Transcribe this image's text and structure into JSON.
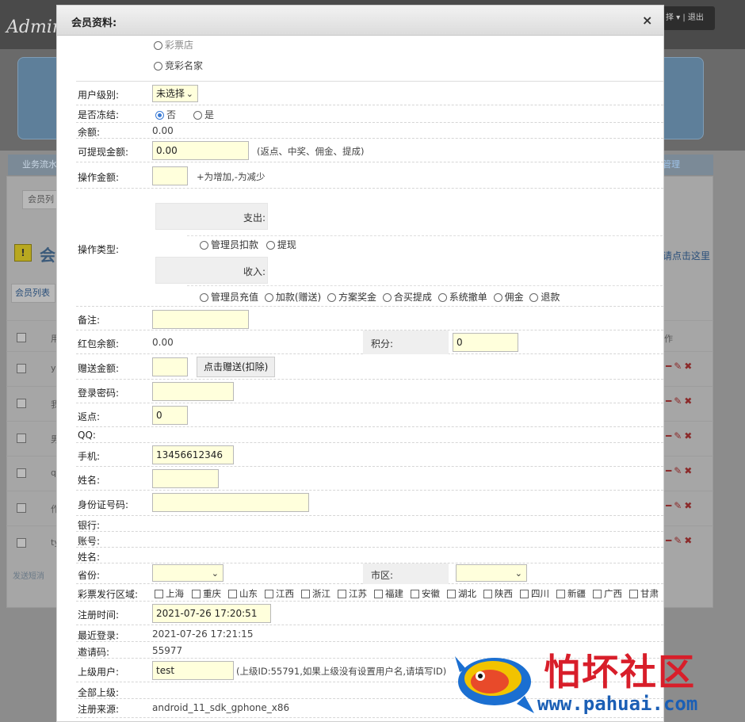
{
  "background": {
    "app_title": "Admin",
    "user_box": "择 ▾ | 退出",
    "nav_left": "业务流水",
    "nav_right": "管理",
    "crumb": "会员列",
    "heading": "会",
    "help_link": "请点击这里",
    "tab": "会员列表",
    "col_head": "用",
    "col_op": "作",
    "rows": [
      "y",
      "我",
      "男",
      "q",
      "作",
      "ty"
    ],
    "footer": "发送短消"
  },
  "modal": {
    "title": "会员资料:",
    "close_symbol": "×",
    "top_partial": "彩票店",
    "top_option": "竞彩名家",
    "level": {
      "label": "用户级别:",
      "value": "未选择"
    },
    "frozen": {
      "label": "是否冻结:",
      "no": "否",
      "yes": "是"
    },
    "balance": {
      "label": "余额:",
      "value": "0.00"
    },
    "withdrawable": {
      "label": "可提现金额:",
      "value": "0.00",
      "hint": "(返点、中奖、佣金、提成)"
    },
    "operate_amount": {
      "label": "操作金额:",
      "value": "",
      "hint": "+为增加,-为减少"
    },
    "operate_type": {
      "label": "操作类型:",
      "expense_label": "支出:",
      "expense_options": [
        "管理员扣款",
        "提现"
      ],
      "income_label": "收入:",
      "income_options": [
        "管理员充值",
        "加款(赠送)",
        "方案奖金",
        "合买提成",
        "系统撤单",
        "佣金",
        "退款"
      ]
    },
    "remark": {
      "label": "备注:",
      "value": ""
    },
    "redpacket": {
      "label": "红包余额:",
      "value": "0.00"
    },
    "points": {
      "label": "积分:",
      "value": "0"
    },
    "gift": {
      "label": "赠送金额:",
      "value": "",
      "button": "点击赠送(扣除)"
    },
    "password": {
      "label": "登录密码:",
      "value": ""
    },
    "rebate": {
      "label": "返点:",
      "value": "0"
    },
    "qq": {
      "label": "QQ:"
    },
    "mobile": {
      "label": "手机:",
      "value": "13456612346"
    },
    "name": {
      "label": "姓名:",
      "value": ""
    },
    "idcard": {
      "label": "身份证号码:",
      "value": ""
    },
    "bank": {
      "label": "银行:"
    },
    "account": {
      "label": "账号:"
    },
    "account_name": {
      "label": "姓名:"
    },
    "province": {
      "label": "省份:",
      "value": ""
    },
    "city": {
      "label": "市区:",
      "value": ""
    },
    "regions": {
      "label": "彩票发行区域:",
      "items": [
        "上海",
        "重庆",
        "山东",
        "江西",
        "浙江",
        "江苏",
        "福建",
        "安徽",
        "湖北",
        "陕西",
        "四川",
        "新疆",
        "广西",
        "甘肃"
      ]
    },
    "reg_time": {
      "label": "注册时间:",
      "value": "2021-07-26 17:20:51"
    },
    "last_login": {
      "label": "最近登录:",
      "value": "2021-07-26 17:21:15"
    },
    "invite": {
      "label": "邀请码:",
      "value": "55977"
    },
    "parent": {
      "label": "上级用户:",
      "value": "test",
      "hint": "(上级ID:55791,如果上级没有设置用户名,请填写ID)"
    },
    "all_parents": {
      "label": "全部上级:"
    },
    "source": {
      "label": "注册来源:",
      "value": "android_11_sdk_gphone_x86"
    }
  },
  "watermark": {
    "text": "怕坏社区",
    "url": "www.pahuai.com"
  }
}
